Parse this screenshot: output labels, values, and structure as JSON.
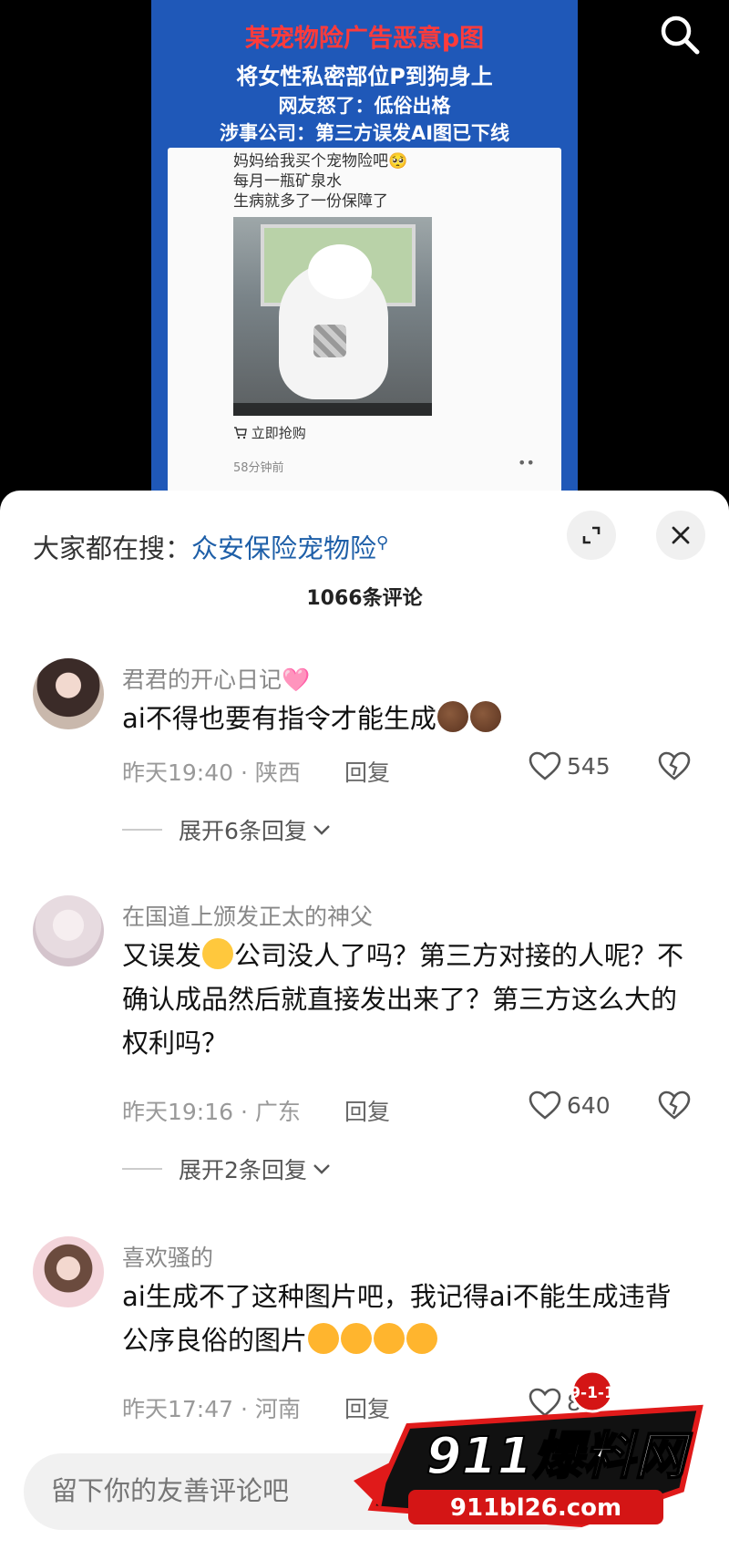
{
  "video": {
    "headline_1": "某宠物险广告恶意p图",
    "headline_2": "将女性私密部位P到狗身上",
    "headline_3": "网友怒了：低俗出格",
    "headline_4": "涉事公司：第三方误发AI图已下线",
    "card_line_1": "妈妈给我买个宠物险吧🥺",
    "card_line_2": "每月一瓶矿泉水",
    "card_line_3": "生病就多了一份保障了",
    "buy_label": "立即抢购",
    "time_ago": "58分钟前",
    "more_dots": "••"
  },
  "sheet": {
    "search_label": "大家都在搜：",
    "search_term": "众安保险宠物险",
    "comment_count": "1066条评论"
  },
  "comments": [
    {
      "username": "君君的开心日记🩷",
      "text": "ai不得也要有指令才能生成",
      "time_location": "昨天19:40 · 陕西",
      "reply_label": "回复",
      "likes": "545",
      "expand_label": "展开6条回复"
    },
    {
      "username": "在国道上颁发正太的神父",
      "text_part_1": "又误发",
      "text_part_2": "公司没人了吗？第三方对接的人呢？不确认成品然后就直接发出来了？第三方这么大的权利吗？",
      "time_location": "昨天19:16 · 广东",
      "reply_label": "回复",
      "likes": "640",
      "expand_label": "展开2条回复"
    },
    {
      "username": "喜欢骚的",
      "text": "ai生成不了这种图片吧，我记得ai不能生成违背公序良俗的图片",
      "time_location": "昨天17:47 · 河南",
      "reply_label": "回复",
      "likes": "86"
    }
  ],
  "input": {
    "placeholder": "留下你的友善评论吧"
  },
  "watermark": {
    "brand": "911爆料网",
    "url": "911bl26.com",
    "badge": "9-1-1"
  },
  "icons": {
    "search": "search-icon",
    "expand": "expand-icon",
    "close": "close-icon",
    "like": "heart-icon",
    "dislike": "broken-heart-icon",
    "chevron": "chevron-down-icon",
    "cart": "cart-icon"
  }
}
